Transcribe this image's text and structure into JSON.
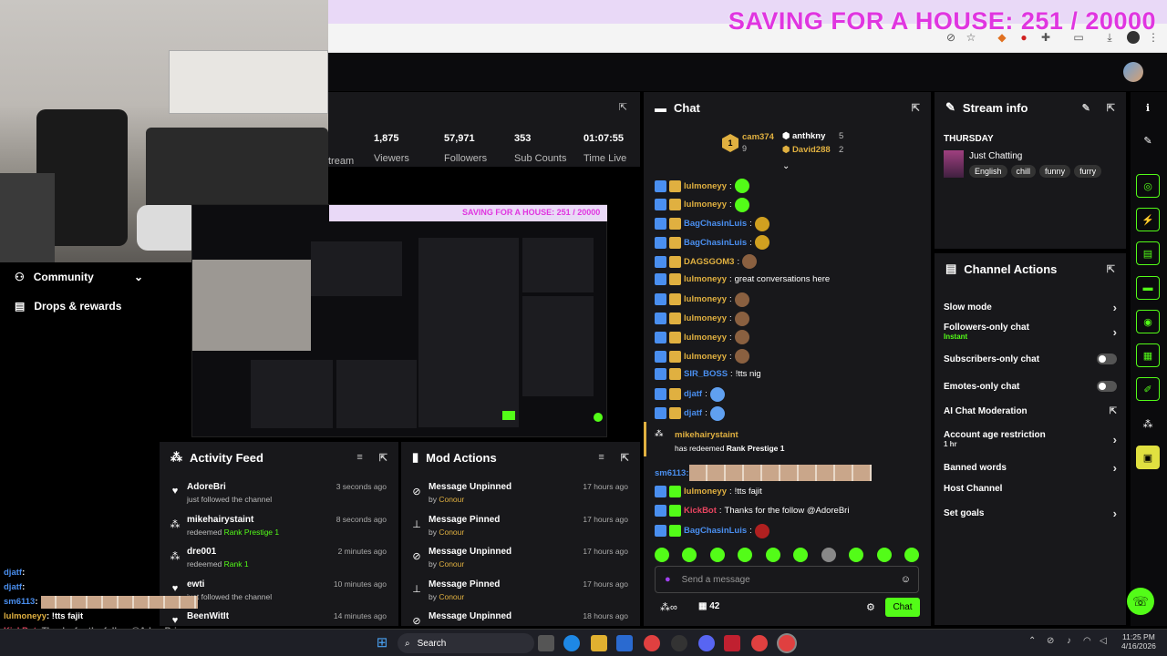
{
  "overlay": {
    "goal_text": "SAVING FOR A HOUSE: 251 / 20000"
  },
  "stats": {
    "partial_label": "tream",
    "viewers": "1,875",
    "viewers_label": "Viewers",
    "followers": "57,971",
    "followers_label": "Followers",
    "subs": "353",
    "subs_label": "Sub Counts",
    "time": "01:07:55",
    "time_label": "Time Live"
  },
  "sidenav": {
    "community": "Community",
    "drops": "Drops & rewards"
  },
  "chat": {
    "title": "Chat",
    "top_gifters": [
      {
        "name": "cam374",
        "count": "9"
      },
      {
        "name": "anthkny",
        "count": "5"
      },
      {
        "name": "David288",
        "count": "2"
      }
    ],
    "messages": [
      {
        "user": "lulmoneyy",
        "text": "",
        "color": "#e0b040"
      },
      {
        "user": "lulmoneyy",
        "text": "",
        "color": "#e0b040"
      },
      {
        "user": "BagChasinLuis",
        "text": "",
        "color": "#4a8ff0"
      },
      {
        "user": "BagChasinLuis",
        "text": "",
        "color": "#4a8ff0"
      },
      {
        "user": "DAGSGOM3",
        "text": "",
        "color": "#e0b040"
      },
      {
        "user": "lulmoneyy",
        "text": "great conversations here",
        "color": "#e0b040"
      },
      {
        "user": "lulmoneyy",
        "text": "",
        "color": "#e0b040"
      },
      {
        "user": "lulmoneyy",
        "text": "",
        "color": "#e0b040"
      },
      {
        "user": "lulmoneyy",
        "text": "",
        "color": "#e0b040"
      },
      {
        "user": "lulmoneyy",
        "text": "",
        "color": "#e0b040"
      },
      {
        "user": "SIR_BOSS",
        "text": "!tts nig",
        "color": "#4a8ff0"
      },
      {
        "user": "djatf",
        "text": "",
        "color": "#4a8ff0"
      },
      {
        "user": "djatf",
        "text": "",
        "color": "#4a8ff0"
      }
    ],
    "redeem": {
      "user": "mikehairystaint",
      "text1": "has redeemed",
      "reward": "Rank Prestige 1"
    },
    "sm_user": "sm6113",
    "tail": [
      {
        "user": "lulmoneyy",
        "text": "!tts fajit",
        "color": "#e0b040"
      },
      {
        "user": "KickBot",
        "text": "Thanks for the follow @AdoreBri",
        "color": "#e94560"
      },
      {
        "user": "BagChasinLuis",
        "text": "",
        "color": "#4a8ff0"
      }
    ],
    "input_placeholder": "Send a message",
    "count": "42",
    "send_label": "Chat"
  },
  "stream_info": {
    "title": "Stream info",
    "day": "THURSDAY",
    "category": "Just Chatting",
    "tags": [
      "English",
      "chill",
      "funny",
      "furry"
    ]
  },
  "channel_actions": {
    "title": "Channel Actions",
    "items": [
      {
        "label": "Slow mode",
        "sub": "",
        "control": "chevron"
      },
      {
        "label": "Followers-only chat",
        "sub": "Instant",
        "control": "chevron"
      },
      {
        "label": "Subscribers-only chat",
        "sub": "",
        "control": "toggle"
      },
      {
        "label": "Emotes-only chat",
        "sub": "",
        "control": "toggle"
      },
      {
        "label": "AI Chat Moderation",
        "sub": "",
        "control": "external"
      },
      {
        "label": "Account age restriction",
        "sub": "1 hr",
        "control": "chevron"
      },
      {
        "label": "Banned words",
        "sub": "",
        "control": "chevron"
      },
      {
        "label": "Host Channel",
        "sub": "",
        "control": "none"
      },
      {
        "label": "Set goals",
        "sub": "",
        "control": "chevron"
      }
    ]
  },
  "activity": {
    "title": "Activity Feed",
    "items": [
      {
        "name": "AdoreBri",
        "sub": "just followed the channel",
        "hl": "",
        "time": "3 seconds ago",
        "icon": "heart"
      },
      {
        "name": "mikehairystaint",
        "sub": "redeemed ",
        "hl": "Rank Prestige 1",
        "time": "8 seconds ago",
        "icon": "redeem"
      },
      {
        "name": "dre001",
        "sub": "redeemed ",
        "hl": "Rank 1",
        "time": "2 minutes ago",
        "icon": "redeem"
      },
      {
        "name": "ewti",
        "sub": "just followed the channel",
        "hl": "",
        "time": "10 minutes ago",
        "icon": "heart"
      },
      {
        "name": "BeenWitIt",
        "sub": "",
        "hl": "",
        "time": "14 minutes ago",
        "icon": "heart"
      }
    ]
  },
  "mod_actions": {
    "title": "Mod Actions",
    "items": [
      {
        "name": "Message Unpinned",
        "by": "by ",
        "mod": "Conour",
        "time": "17 hours ago"
      },
      {
        "name": "Message Pinned",
        "by": "by ",
        "mod": "Conour",
        "time": "17 hours ago"
      },
      {
        "name": "Message Unpinned",
        "by": "by ",
        "mod": "Conour",
        "time": "17 hours ago"
      },
      {
        "name": "Message Pinned",
        "by": "by ",
        "mod": "Conour",
        "time": "17 hours ago"
      },
      {
        "name": "Message Unpinned",
        "by": "",
        "mod": "",
        "time": "18 hours ago"
      }
    ]
  },
  "overlay_chat": [
    {
      "user": "djatf",
      "text": ":"
    },
    {
      "user": "djatf",
      "text": ":"
    },
    {
      "user": "sm6113",
      "text": ":"
    },
    {
      "user": "lulmoneyy",
      "text": ": !tts fajit"
    },
    {
      "user": "KickBot",
      "text": ": Thanks for the follow @AdoreBri"
    },
    {
      "user": "BagChasinLuis",
      "text": ":"
    }
  ],
  "taskbar": {
    "search": "Search",
    "time": "11:25 PM",
    "date": "4/16/2026"
  },
  "preview_goal": "SAVING FOR A HOUSE: 251 / 20000",
  "colors": {
    "kick_green": "#53fc18",
    "panel": "#18181b",
    "goal_magenta": "#e036e0"
  }
}
